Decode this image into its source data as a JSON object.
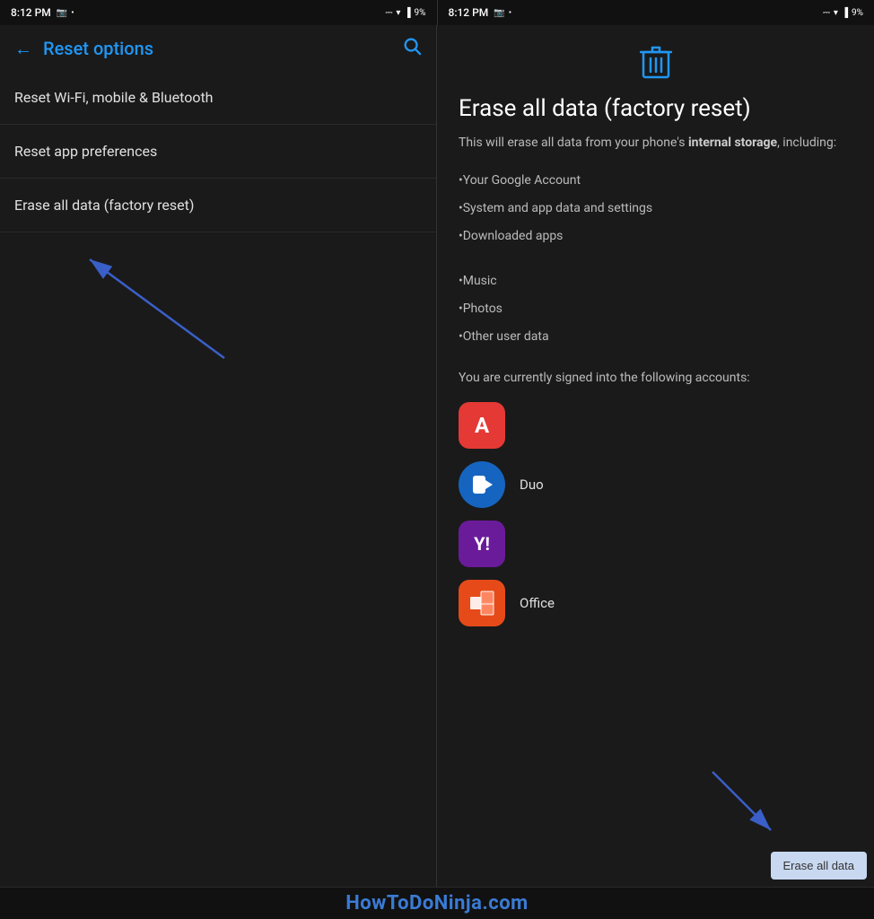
{
  "left_status": {
    "time": "8:12 PM",
    "icons": [
      "📷",
      "•"
    ]
  },
  "right_status": {
    "time": "8:12 PM",
    "icons": [
      "📷",
      "•"
    ]
  },
  "battery": "9%",
  "left_panel": {
    "back_label": "←",
    "title": "Reset options",
    "search_label": "🔍",
    "menu_items": [
      {
        "label": "Reset Wi-Fi, mobile & Bluetooth"
      },
      {
        "label": "Reset app preferences"
      },
      {
        "label": "Erase all data (factory reset)"
      }
    ]
  },
  "right_panel": {
    "title": "Erase all data (factory reset)",
    "description_normal": "This will erase all data from your phone's ",
    "description_bold": "internal storage",
    "description_end": ", including:",
    "bullets": [
      "•Your Google Account",
      "•System and app data and settings",
      "•Downloaded apps",
      "•Music",
      "•Photos",
      "•Other user data"
    ],
    "accounts_text": "You are currently signed into the following accounts:",
    "apps": [
      {
        "name": "Adobe",
        "label": "A",
        "style": "adobe"
      },
      {
        "name": "Duo",
        "label": "▶",
        "style": "duo"
      },
      {
        "name": "Yahoo",
        "label": "Y!",
        "style": "yahoo"
      },
      {
        "name": "Office",
        "label": "⊞",
        "style": "office"
      }
    ],
    "erase_button": "Erase all data"
  },
  "watermark": "HowToDoNinja.com"
}
